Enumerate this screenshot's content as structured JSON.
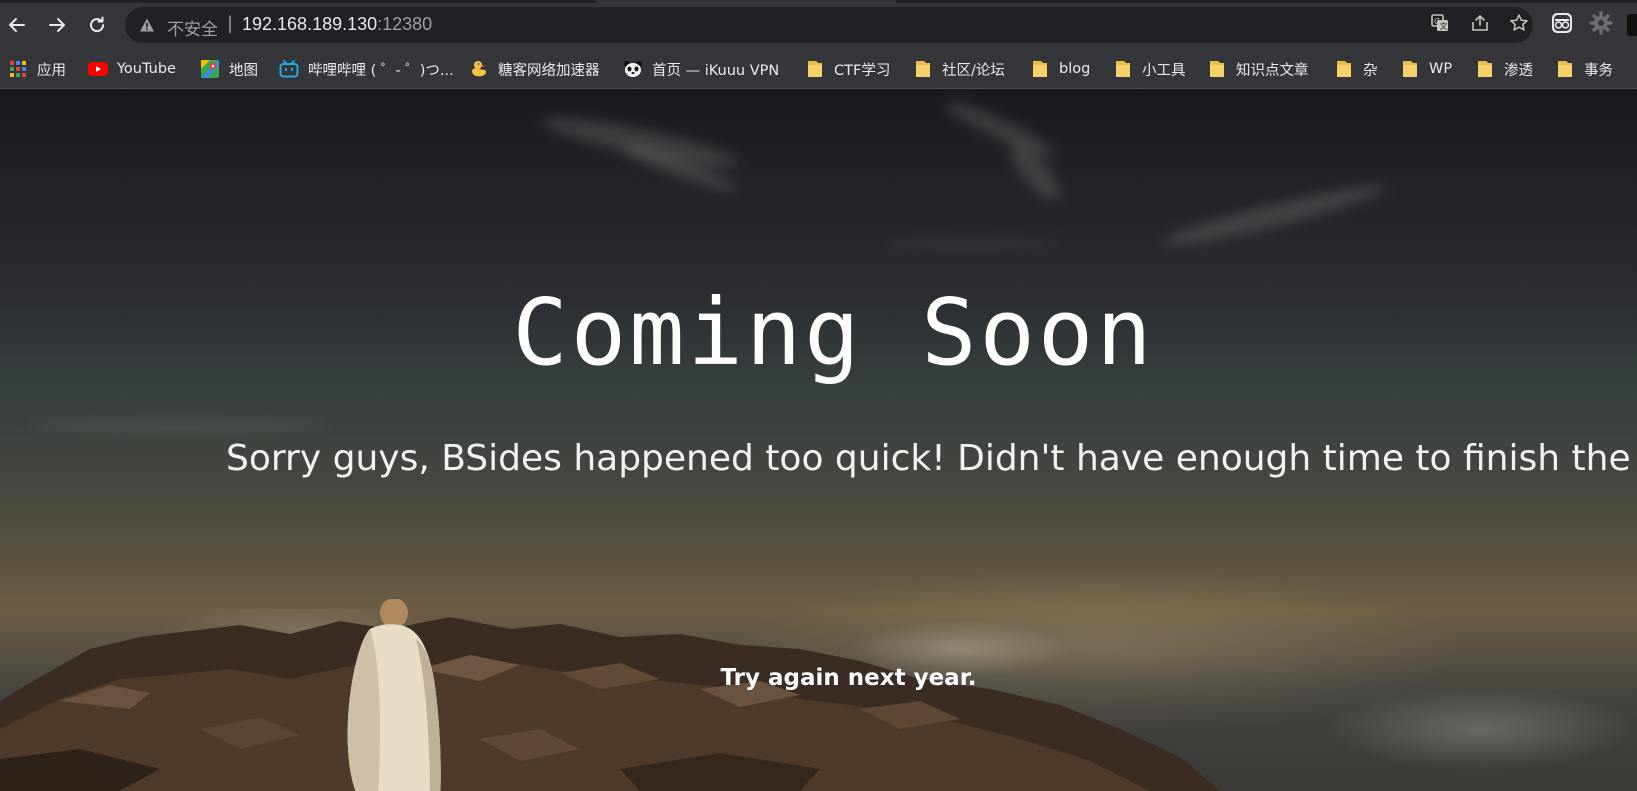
{
  "browser": {
    "omnibox": {
      "security_label": "不安全",
      "separator": "|",
      "url_host": "192.168.189.130",
      "url_port": ":12380"
    },
    "bookmarks": [
      {
        "label": "应用",
        "icon": "apps-grid-icon"
      },
      {
        "label": "YouTube",
        "icon": "youtube-icon"
      },
      {
        "label": "地图",
        "icon": "maps-icon"
      },
      {
        "label": "哔哩哔哩 ( ゜- ゜)つ...",
        "icon": "bilibili-icon"
      },
      {
        "label": "糖客网络加速器",
        "icon": "duck-icon"
      },
      {
        "label": "首页 — iKuuu VPN",
        "icon": "panda-icon"
      },
      {
        "label": "CTF学习",
        "icon": "folder-icon"
      },
      {
        "label": "社区/论坛",
        "icon": "folder-icon"
      },
      {
        "label": "blog",
        "icon": "folder-icon"
      },
      {
        "label": "小工具",
        "icon": "folder-icon"
      },
      {
        "label": "知识点文章",
        "icon": "folder-icon"
      },
      {
        "label": "杂",
        "icon": "folder-icon"
      },
      {
        "label": "WP",
        "icon": "folder-icon"
      },
      {
        "label": "渗透",
        "icon": "folder-icon"
      },
      {
        "label": "事务",
        "icon": "folder-icon"
      }
    ]
  },
  "page": {
    "title": "Coming Soon",
    "subtitle": "Sorry guys, BSides happened too quick! Didn't have enough time to finish the website.",
    "footer": "Try again next year."
  },
  "colors": {
    "toolbar": "#35363a",
    "omnibox": "#202124",
    "text": "#e8eaed",
    "muted": "#9aa0a6",
    "folder": "#f5d06b"
  }
}
